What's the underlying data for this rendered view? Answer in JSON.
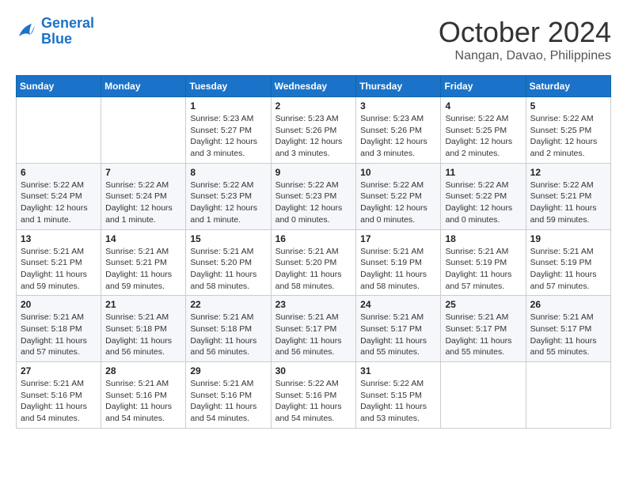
{
  "header": {
    "logo_line1": "General",
    "logo_line2": "Blue",
    "month": "October 2024",
    "location": "Nangan, Davao, Philippines"
  },
  "days_of_week": [
    "Sunday",
    "Monday",
    "Tuesday",
    "Wednesday",
    "Thursday",
    "Friday",
    "Saturday"
  ],
  "weeks": [
    [
      {
        "day": "",
        "info": ""
      },
      {
        "day": "",
        "info": ""
      },
      {
        "day": "1",
        "info": "Sunrise: 5:23 AM\nSunset: 5:27 PM\nDaylight: 12 hours and 3 minutes."
      },
      {
        "day": "2",
        "info": "Sunrise: 5:23 AM\nSunset: 5:26 PM\nDaylight: 12 hours and 3 minutes."
      },
      {
        "day": "3",
        "info": "Sunrise: 5:23 AM\nSunset: 5:26 PM\nDaylight: 12 hours and 3 minutes."
      },
      {
        "day": "4",
        "info": "Sunrise: 5:22 AM\nSunset: 5:25 PM\nDaylight: 12 hours and 2 minutes."
      },
      {
        "day": "5",
        "info": "Sunrise: 5:22 AM\nSunset: 5:25 PM\nDaylight: 12 hours and 2 minutes."
      }
    ],
    [
      {
        "day": "6",
        "info": "Sunrise: 5:22 AM\nSunset: 5:24 PM\nDaylight: 12 hours and 1 minute."
      },
      {
        "day": "7",
        "info": "Sunrise: 5:22 AM\nSunset: 5:24 PM\nDaylight: 12 hours and 1 minute."
      },
      {
        "day": "8",
        "info": "Sunrise: 5:22 AM\nSunset: 5:23 PM\nDaylight: 12 hours and 1 minute."
      },
      {
        "day": "9",
        "info": "Sunrise: 5:22 AM\nSunset: 5:23 PM\nDaylight: 12 hours and 0 minutes."
      },
      {
        "day": "10",
        "info": "Sunrise: 5:22 AM\nSunset: 5:22 PM\nDaylight: 12 hours and 0 minutes."
      },
      {
        "day": "11",
        "info": "Sunrise: 5:22 AM\nSunset: 5:22 PM\nDaylight: 12 hours and 0 minutes."
      },
      {
        "day": "12",
        "info": "Sunrise: 5:22 AM\nSunset: 5:21 PM\nDaylight: 11 hours and 59 minutes."
      }
    ],
    [
      {
        "day": "13",
        "info": "Sunrise: 5:21 AM\nSunset: 5:21 PM\nDaylight: 11 hours and 59 minutes."
      },
      {
        "day": "14",
        "info": "Sunrise: 5:21 AM\nSunset: 5:21 PM\nDaylight: 11 hours and 59 minutes."
      },
      {
        "day": "15",
        "info": "Sunrise: 5:21 AM\nSunset: 5:20 PM\nDaylight: 11 hours and 58 minutes."
      },
      {
        "day": "16",
        "info": "Sunrise: 5:21 AM\nSunset: 5:20 PM\nDaylight: 11 hours and 58 minutes."
      },
      {
        "day": "17",
        "info": "Sunrise: 5:21 AM\nSunset: 5:19 PM\nDaylight: 11 hours and 58 minutes."
      },
      {
        "day": "18",
        "info": "Sunrise: 5:21 AM\nSunset: 5:19 PM\nDaylight: 11 hours and 57 minutes."
      },
      {
        "day": "19",
        "info": "Sunrise: 5:21 AM\nSunset: 5:19 PM\nDaylight: 11 hours and 57 minutes."
      }
    ],
    [
      {
        "day": "20",
        "info": "Sunrise: 5:21 AM\nSunset: 5:18 PM\nDaylight: 11 hours and 57 minutes."
      },
      {
        "day": "21",
        "info": "Sunrise: 5:21 AM\nSunset: 5:18 PM\nDaylight: 11 hours and 56 minutes."
      },
      {
        "day": "22",
        "info": "Sunrise: 5:21 AM\nSunset: 5:18 PM\nDaylight: 11 hours and 56 minutes."
      },
      {
        "day": "23",
        "info": "Sunrise: 5:21 AM\nSunset: 5:17 PM\nDaylight: 11 hours and 56 minutes."
      },
      {
        "day": "24",
        "info": "Sunrise: 5:21 AM\nSunset: 5:17 PM\nDaylight: 11 hours and 55 minutes."
      },
      {
        "day": "25",
        "info": "Sunrise: 5:21 AM\nSunset: 5:17 PM\nDaylight: 11 hours and 55 minutes."
      },
      {
        "day": "26",
        "info": "Sunrise: 5:21 AM\nSunset: 5:17 PM\nDaylight: 11 hours and 55 minutes."
      }
    ],
    [
      {
        "day": "27",
        "info": "Sunrise: 5:21 AM\nSunset: 5:16 PM\nDaylight: 11 hours and 54 minutes."
      },
      {
        "day": "28",
        "info": "Sunrise: 5:21 AM\nSunset: 5:16 PM\nDaylight: 11 hours and 54 minutes."
      },
      {
        "day": "29",
        "info": "Sunrise: 5:21 AM\nSunset: 5:16 PM\nDaylight: 11 hours and 54 minutes."
      },
      {
        "day": "30",
        "info": "Sunrise: 5:22 AM\nSunset: 5:16 PM\nDaylight: 11 hours and 54 minutes."
      },
      {
        "day": "31",
        "info": "Sunrise: 5:22 AM\nSunset: 5:15 PM\nDaylight: 11 hours and 53 minutes."
      },
      {
        "day": "",
        "info": ""
      },
      {
        "day": "",
        "info": ""
      }
    ]
  ]
}
